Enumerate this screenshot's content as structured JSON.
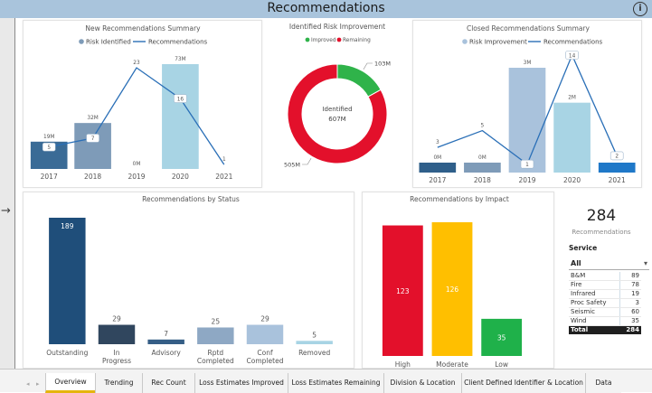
{
  "header": {
    "title": "Recommendations",
    "info_icon": "info-icon",
    "info_glyph": "i"
  },
  "side": {
    "expand_icon": "arrow-right-icon",
    "glyph": "→"
  },
  "new_summary": {
    "title": "New Recommendations Summary",
    "legend": [
      "Risk Identified",
      "Recommendations"
    ],
    "chart_data": {
      "type": "bar",
      "categories": [
        "2017",
        "2018",
        "2019",
        "2020",
        "2021"
      ],
      "series": [
        {
          "name": "Risk Identified",
          "values": [
            19,
            32,
            0,
            73,
            0
          ],
          "labels": [
            "19M",
            "32M",
            "0M",
            "73M",
            ""
          ],
          "colors": [
            "#3a6b96",
            "#7e9bb8",
            "#7e9bb8",
            "#a8d4e4",
            "#a8d4e4"
          ]
        },
        {
          "name": "Recommendations",
          "values": [
            5,
            7,
            23,
            16,
            1
          ],
          "labels": [
            "5",
            "7",
            "23",
            "16",
            "1"
          ]
        }
      ]
    }
  },
  "risk_improvement": {
    "title": "Identified Risk Improvement",
    "legend": [
      "Improved",
      "Remaining"
    ],
    "center_label": "Identified",
    "center_value": "607M",
    "chart_data": {
      "type": "pie",
      "slices": [
        {
          "name": "Improved",
          "value": 103,
          "label": "103M",
          "color": "#2fb34a"
        },
        {
          "name": "Remaining",
          "value": 505,
          "label": "505M",
          "color": "#e3102b"
        }
      ]
    }
  },
  "closed_summary": {
    "title": "Closed Recommendations Summary",
    "legend": [
      "Risk Improvement",
      "Recommendations"
    ],
    "chart_data": {
      "type": "bar",
      "categories": [
        "2017",
        "2018",
        "2019",
        "2020",
        "2021"
      ],
      "series": [
        {
          "name": "Risk Improvement",
          "values": [
            0,
            0,
            3,
            2,
            0
          ],
          "labels": [
            "0M",
            "0M",
            "3M",
            "2M",
            "0M"
          ],
          "colors": [
            "#2f5f8a",
            "#7e9bb8",
            "#a9c2dc",
            "#a8d4e4",
            "#1f78c8"
          ]
        },
        {
          "name": "Recommendations",
          "values": [
            3,
            5,
            1,
            14,
            2
          ],
          "labels": [
            "3",
            "5",
            "1",
            "14",
            "2"
          ]
        }
      ]
    }
  },
  "by_status": {
    "title": "Recommendations by Status",
    "chart_data": {
      "type": "bar",
      "categories": [
        "Outstanding",
        "In Progress",
        "Advisory",
        "Rptd Completed",
        "Conf Completed",
        "Removed"
      ],
      "values": [
        189,
        29,
        7,
        25,
        29,
        5
      ],
      "colors": [
        "#1f4e7a",
        "#30465e",
        "#355e86",
        "#8ea8c4",
        "#a9c2dc",
        "#a8d4e4"
      ]
    }
  },
  "by_impact": {
    "title": "Recommendations by Impact",
    "chart_data": {
      "type": "bar",
      "categories": [
        "High",
        "Moderate",
        "Low"
      ],
      "values": [
        123,
        126,
        35
      ],
      "colors": [
        "#e3102b",
        "#ffbf00",
        "#1fb14a"
      ]
    }
  },
  "kpi": {
    "value": "284",
    "label": "Recommendations"
  },
  "service": {
    "title": "Service",
    "selected": "All",
    "chevron": "▾",
    "rows": [
      {
        "name": "B&M",
        "count": "89"
      },
      {
        "name": "Fire",
        "count": "78"
      },
      {
        "name": "Infrared",
        "count": "19"
      },
      {
        "name": "Proc Safety",
        "count": "3"
      },
      {
        "name": "Seismic",
        "count": "60"
      },
      {
        "name": "Wind",
        "count": "35"
      }
    ],
    "total": {
      "name": "Total",
      "count": "284"
    }
  },
  "tabs": {
    "prev": "◂",
    "next": "▸",
    "items": [
      "Overview",
      "Trending",
      "Rec Count",
      "Loss Estimates Improved",
      "Loss Estimates Remaining",
      "Division & Location",
      "Client Defined Identifier & Location",
      "Data"
    ],
    "active": "Overview"
  },
  "colors": {
    "header": "#a9c4dc",
    "line": "#2a6fb7",
    "tab_active": "#e5b50e"
  }
}
